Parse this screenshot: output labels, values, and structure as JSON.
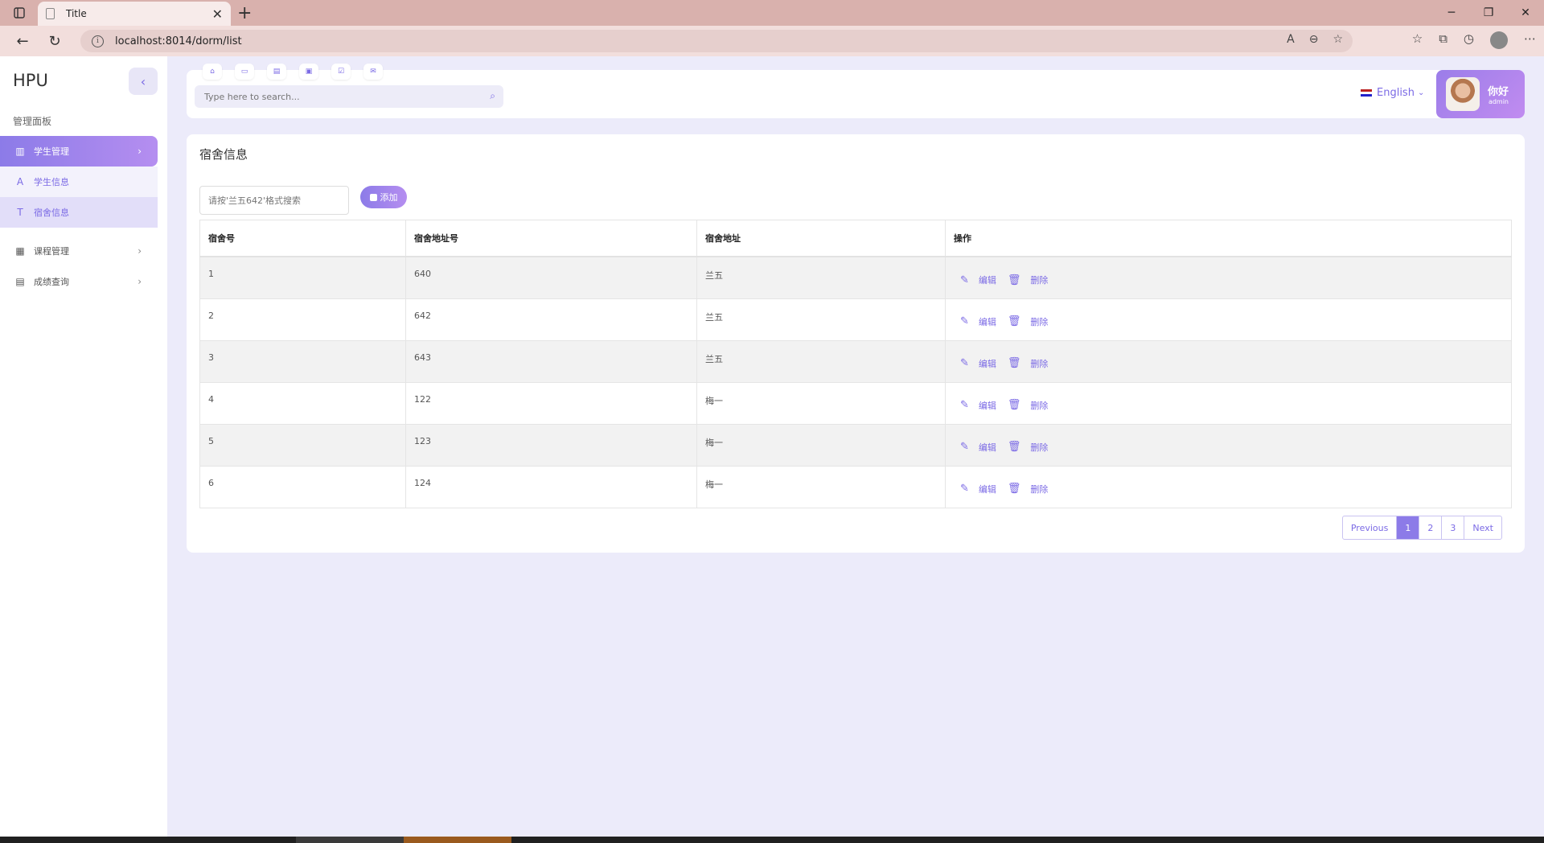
{
  "browser": {
    "tab_title": "Title",
    "url": "localhost:8014/dorm/list"
  },
  "sidebar": {
    "brand": "HPU",
    "section_title": "管理面板",
    "menu": [
      {
        "label": "学生管理",
        "icon": "book-icon",
        "active": true
      },
      {
        "label": "学生信息",
        "icon": "letter-a-icon"
      },
      {
        "label": "宿舍信息",
        "icon": "letter-t-icon",
        "selected": true
      },
      {
        "label": "课程管理",
        "icon": "table-icon"
      },
      {
        "label": "成绩查询",
        "icon": "calculator-icon"
      }
    ]
  },
  "header": {
    "search_placeholder": "Type here to search...",
    "language": "English",
    "greeting": "你好",
    "username": "admin"
  },
  "main": {
    "title": "宿舍信息",
    "filter_placeholder": "请按'兰五642'格式搜索",
    "add_label": "添加",
    "columns": [
      "宿舍号",
      "宿舍地址号",
      "宿舍地址",
      "操作"
    ],
    "rows": [
      {
        "id": "1",
        "room": "640",
        "building": "兰五"
      },
      {
        "id": "2",
        "room": "642",
        "building": "兰五"
      },
      {
        "id": "3",
        "room": "643",
        "building": "兰五"
      },
      {
        "id": "4",
        "room": "122",
        "building": "梅一"
      },
      {
        "id": "5",
        "room": "123",
        "building": "梅一"
      },
      {
        "id": "6",
        "room": "124",
        "building": "梅一"
      }
    ],
    "edit_label": "编辑",
    "delete_label": "删除",
    "pagination": {
      "previous": "Previous",
      "pages": [
        "1",
        "2",
        "3"
      ],
      "current": "1",
      "next": "Next"
    }
  },
  "colors": {
    "accent": "#8c7be8",
    "accent_light": "#b58ef0",
    "page_bg": "#ecebfa",
    "tabbar": "#d9b1ad"
  }
}
